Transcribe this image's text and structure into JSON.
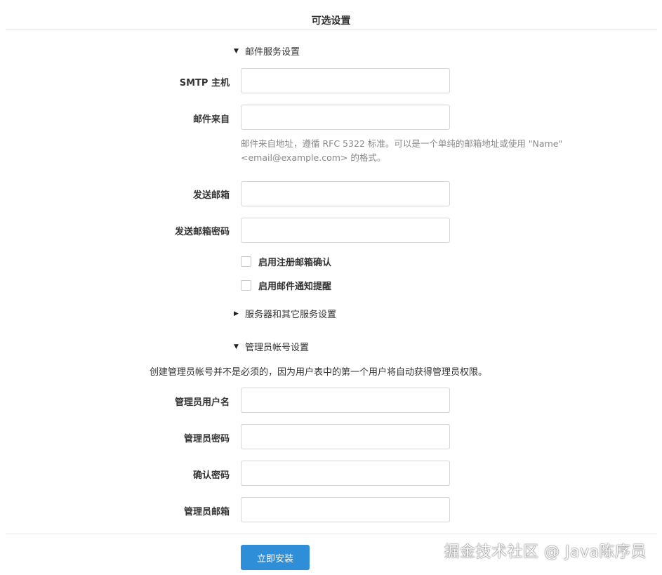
{
  "page": {
    "title": "可选设置"
  },
  "sections": {
    "email": {
      "label": "邮件服务设置",
      "expanded": true
    },
    "server": {
      "label": "服务器和其它服务设置",
      "expanded": false
    },
    "admin": {
      "label": "管理员帐号设置",
      "expanded": true
    }
  },
  "email_fields": {
    "smtp_host": {
      "label": "SMTP 主机",
      "value": ""
    },
    "mail_from": {
      "label": "邮件来自",
      "value": "",
      "help_line1": "邮件来自地址，遵循 RFC 5322 标准。可以是一个单纯的邮箱地址或使用 \"Name\"",
      "help_line2": "<email@example.com> 的格式。"
    },
    "sender_email": {
      "label": "发送邮箱",
      "value": ""
    },
    "sender_password": {
      "label": "发送邮箱密码",
      "value": ""
    },
    "enable_register_confirm": {
      "label": "启用注册邮箱确认",
      "checked": false
    },
    "enable_mail_notify": {
      "label": "启用邮件通知提醒",
      "checked": false
    }
  },
  "admin_fields": {
    "note": "创建管理员帐号并不是必须的，因为用户表中的第一个用户将自动获得管理员权限。",
    "username": {
      "label": "管理员用户名",
      "value": ""
    },
    "password": {
      "label": "管理员密码",
      "value": ""
    },
    "confirm_password": {
      "label": "确认密码",
      "value": ""
    },
    "email": {
      "label": "管理员邮箱",
      "value": ""
    }
  },
  "actions": {
    "install_label": "立即安装"
  },
  "watermark": "掘金技术社区 @ Java陈序员",
  "icons": {
    "caret_down": "caret-down-icon",
    "caret_right": "caret-right-icon"
  },
  "colors": {
    "primary_button": "#2e8ed8",
    "help_text": "#888888",
    "border": "#d6d6d6"
  }
}
